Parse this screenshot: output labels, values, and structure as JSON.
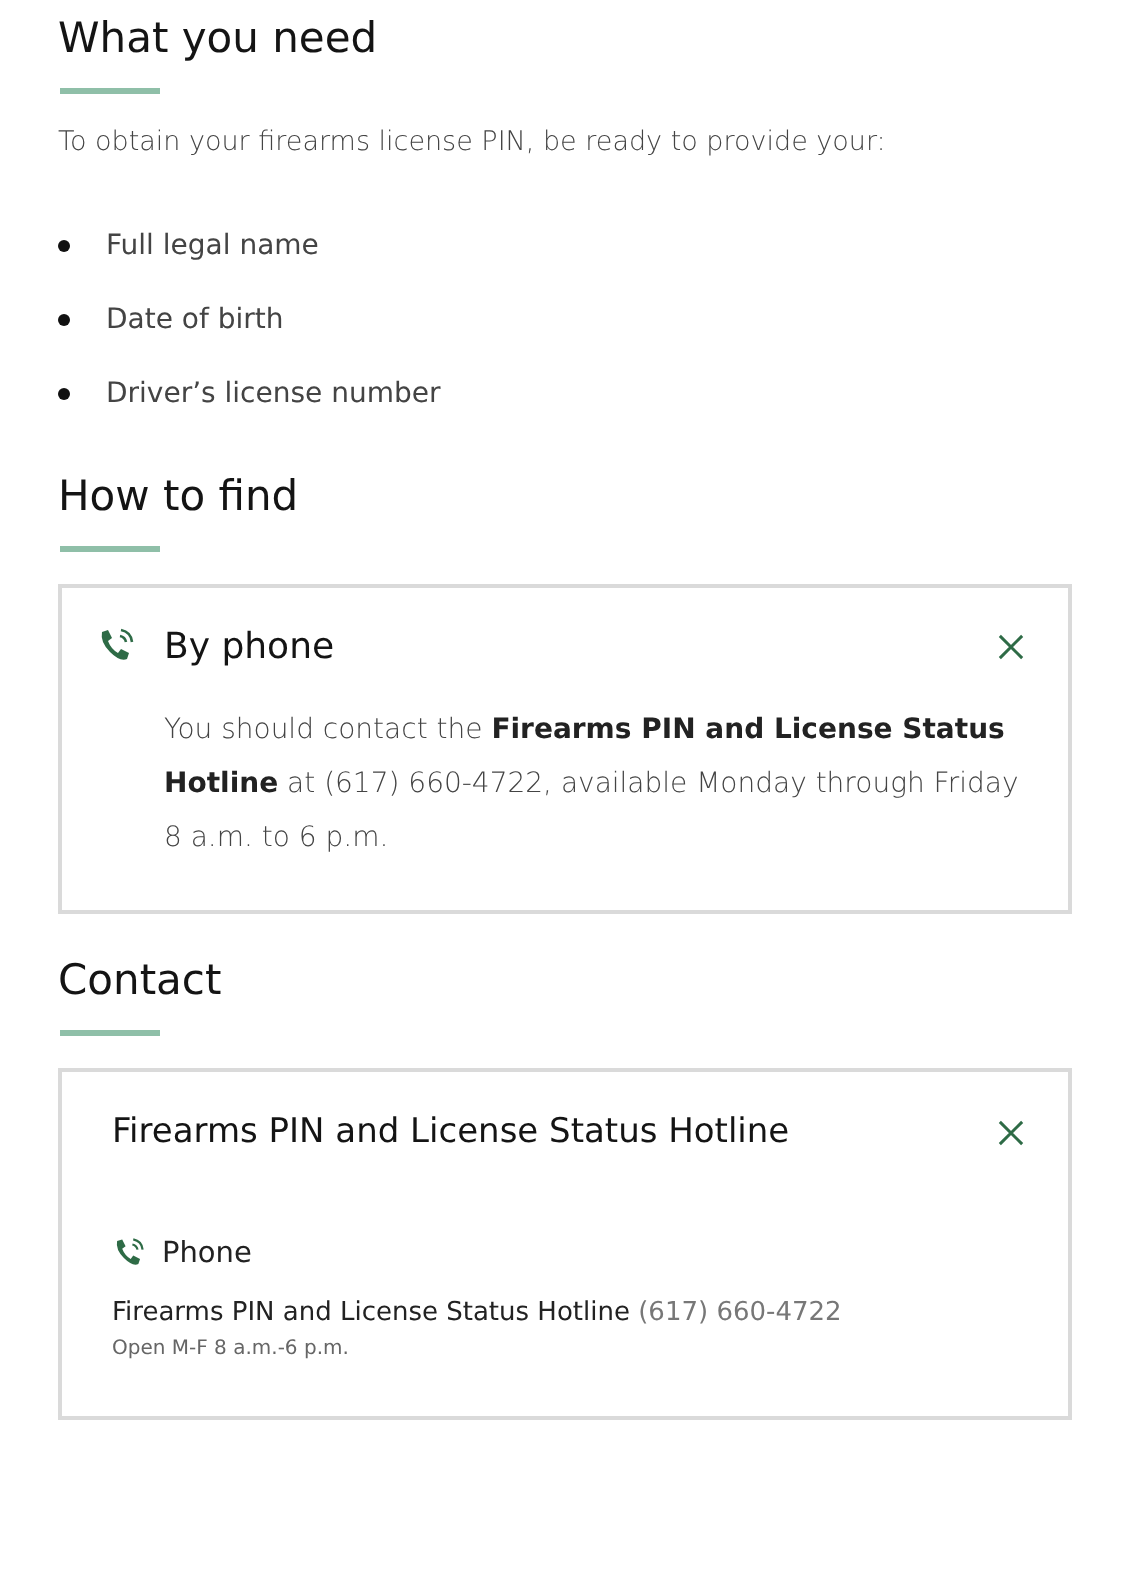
{
  "sections": [
    {
      "heading": "What you need",
      "intro": "To obtain your firearms license PIN, be ready to provide your:",
      "items": [
        "Full legal name",
        "Date of birth",
        "Driver’s license number"
      ]
    },
    {
      "heading": "How to find",
      "panel": {
        "kind": "method",
        "title": "By phone",
        "expanded": true,
        "body": "You should contact the **Firearms PIN and License Status Hotline** at (617) 660-4722, available Monday through Friday 8 a.m. to 6 p.m."
      }
    },
    {
      "heading": "Contact",
      "panel": {
        "kind": "contact",
        "title": "Firearms PIN and License Status Hotline",
        "expanded": true,
        "channel": "Phone",
        "name": "Firearms PIN and License Status Hotline",
        "number": "(617) 660-4722",
        "hours": "Open M-F 8 a.m.-6 p.m."
      }
    }
  ]
}
